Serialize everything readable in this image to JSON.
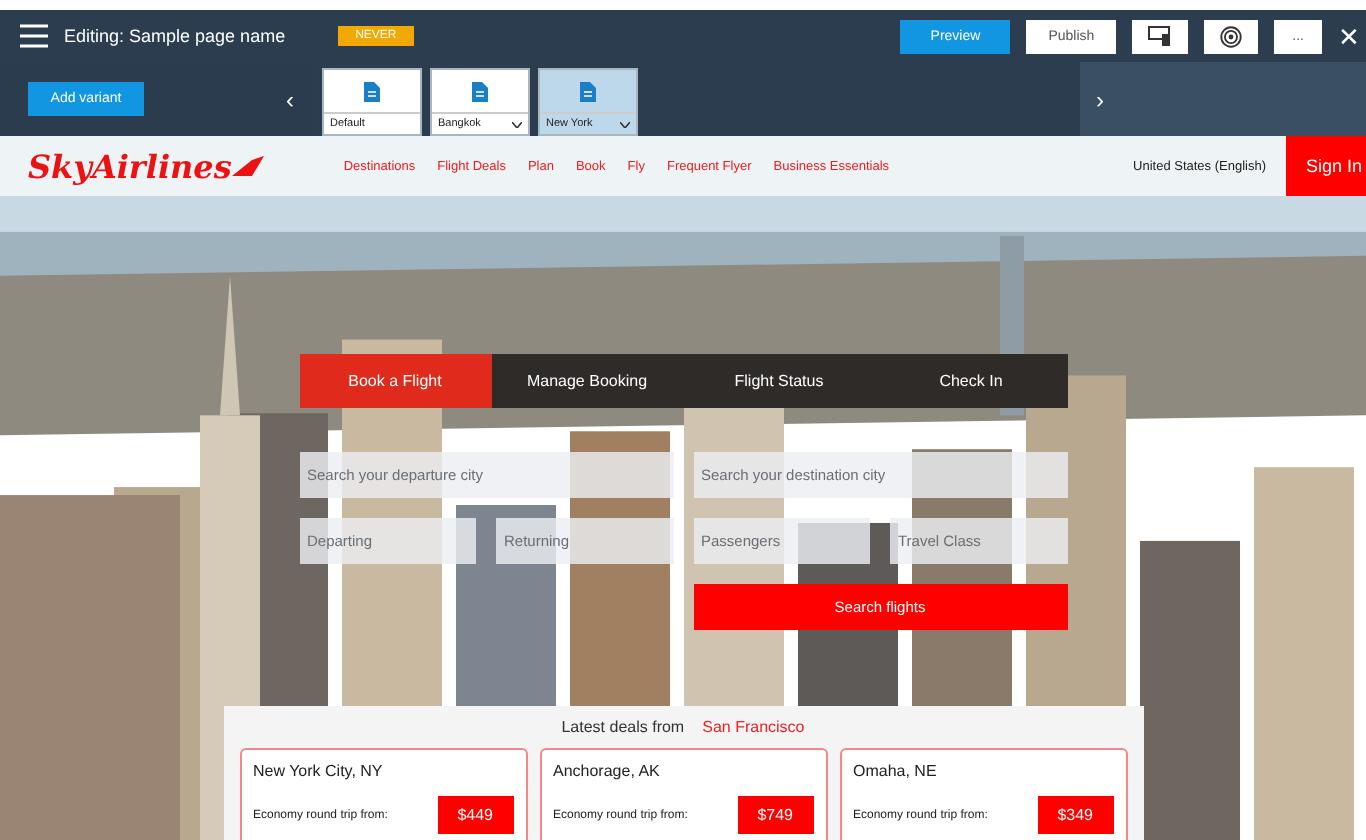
{
  "editor": {
    "title": "Editing: Sample page name",
    "badge": "NEVER",
    "buttons": [
      {
        "label": "Preview",
        "kind": "primary"
      },
      {
        "label": "Publish",
        "kind": "plain"
      },
      {
        "kind": "device"
      },
      {
        "kind": "target"
      },
      {
        "label": "...",
        "kind": "plain"
      }
    ],
    "close": "✕"
  },
  "variants": {
    "add_label": "Add variant",
    "prev": "‹",
    "next": "›",
    "items": [
      {
        "label": "Default",
        "dropdown": false,
        "selected": false
      },
      {
        "label": "Bangkok",
        "dropdown": true,
        "selected": false
      },
      {
        "label": "New York",
        "dropdown": true,
        "selected": true
      }
    ]
  },
  "site": {
    "logo": "SkyAirlines",
    "nav": [
      "Destinations",
      "Flight Deals",
      "Plan",
      "Book",
      "Fly",
      "Frequent Flyer",
      "Business Essentials"
    ],
    "locale": "United States (English)",
    "sign_in": "Sign In"
  },
  "booking": {
    "tabs": [
      {
        "label": "Book a Flight",
        "selected": true
      },
      {
        "label": "Manage Booking",
        "selected": false
      },
      {
        "label": "Flight Status",
        "selected": false
      },
      {
        "label": "Check In",
        "selected": false
      }
    ],
    "fields_row1": [
      {
        "placeholder": "Search your departure city"
      },
      {
        "placeholder": "Search your destination city"
      }
    ],
    "fields_row2": [
      {
        "placeholder": "Departing"
      },
      {
        "placeholder": "Returning"
      },
      {
        "placeholder": "Passengers"
      },
      {
        "placeholder": "Travel Class"
      }
    ],
    "search": "Search flights"
  },
  "deals": {
    "heading": "Latest deals from",
    "origin": "San Francisco",
    "cards": [
      {
        "city": "New York City, NY",
        "label": "Economy round trip from:",
        "price": "$449"
      },
      {
        "city": "Anchorage, AK",
        "label": "Economy round trip from:",
        "price": "$749"
      },
      {
        "city": "Omaha, NE",
        "label": "Economy round trip from:",
        "price": "$349"
      }
    ]
  }
}
